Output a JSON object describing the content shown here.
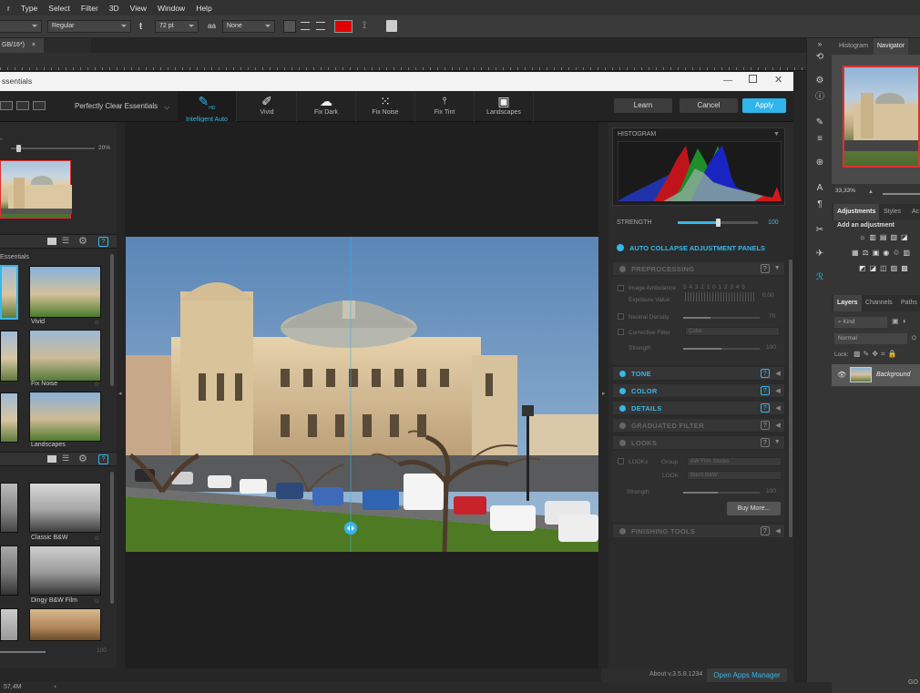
{
  "ps": {
    "menu": [
      "r",
      "Type",
      "Select",
      "Filter",
      "3D",
      "View",
      "Window",
      "Help"
    ],
    "options": {
      "font_style": "Regular",
      "font_size": "72 pt",
      "antialias_icon": "aa",
      "antialias": "None"
    },
    "doc_tab": "GB/16*)",
    "doc_tab_close": "×",
    "status": "57,4M",
    "status_arrow": "›",
    "toolbar_collapse": "»",
    "panel_tabs": {
      "histogram": "Histogram",
      "navigator": "Navigator"
    },
    "zoom": "33,33%",
    "adjust_tabs": {
      "adjustments": "Adjustments",
      "styles": "Styles",
      "actions": "Ac"
    },
    "add_adjustment": "Add an adjustment",
    "layers_tabs": {
      "layers": "Layers",
      "channels": "Channels",
      "paths": "Paths"
    },
    "kind": "Kind",
    "blend": "Normal",
    "opacity_short": "O",
    "lock": "Lock:",
    "layer_name": "Background",
    "bottom_icons": "GO"
  },
  "plugin": {
    "title": "ssentials",
    "preset_mode": "Perfectly Clear Essentials",
    "tools": [
      {
        "label": "Intelligent Auto",
        "icon": "brush-hd-icon",
        "glyph": "✎"
      },
      {
        "label": "Vivid",
        "icon": "brush-icon",
        "glyph": "✐"
      },
      {
        "label": "Fix Dark",
        "icon": "cloud-icon",
        "glyph": "☁"
      },
      {
        "label": "Fix Noise",
        "icon": "noise-icon",
        "glyph": "⁙"
      },
      {
        "label": "Fix Tint",
        "icon": "thermometer-icon",
        "glyph": "🌡"
      },
      {
        "label": "Landscapes",
        "icon": "landscape-icon",
        "glyph": "▣"
      }
    ],
    "hd_badge": "HD",
    "learn": "Learn",
    "cancel": "Cancel",
    "apply": "Apply",
    "zoom_pct": "20%",
    "section1": "Essentials",
    "thumbs1": [
      {
        "label": ""
      },
      {
        "label": "Vivid"
      },
      {
        "label": ""
      },
      {
        "label": "Fix Noise"
      },
      {
        "label": ""
      },
      {
        "label": "Landscapes"
      }
    ],
    "thumbs2": [
      {
        "label": ""
      },
      {
        "label": "Classic B&W"
      },
      {
        "label": ""
      },
      {
        "label": "Dingy B&W Film"
      },
      {
        "label": ""
      },
      {
        "label": ""
      }
    ],
    "amount": "100",
    "histogram_label": "HISTOGRAM",
    "strength_label": "STRENGTH",
    "strength_value": 100,
    "strength_fraction": 0.5,
    "auto_collapse": "AUTO COLLAPSE ADJUSTMENT PANELS",
    "preprocessing": {
      "title": "PREPROCESSING",
      "image_ambulance": "Image Ambulance",
      "ambulance_scale": "5 4 3 2 1 0 1 2 3 4 5",
      "exposure_value": "Exposure Value",
      "exposure": "0,00",
      "neutral_density": "Neutral Density",
      "nd_value": "70",
      "corrective_filter": "Corrective Filter",
      "filter_value": "Color",
      "strength": "Strength",
      "strength_value": "100"
    },
    "panels_active": [
      "TONE",
      "COLOR",
      "DETAILS"
    ],
    "graduated": "GRADUATED FILTER",
    "looks": {
      "title": "LOOKS",
      "looks_label": "LOOKs",
      "group_label": "Group",
      "group": "BW Film Stocks",
      "look_label": "LOOK",
      "look": "Burnt B&W",
      "strength": "Strength",
      "strength_value": "100",
      "buy_more": "Buy More..."
    },
    "finishing": "FINISHING TOOLS",
    "about": "About v.3.5.8.1234",
    "open_apps": "Open Apps Manager",
    "help": "?",
    "left_arrow": "◂",
    "right_arrow": "▸"
  },
  "colors": {
    "accent": "#37b7e8",
    "red_swatch": "#e00000",
    "apply": "#2fb5ea"
  }
}
